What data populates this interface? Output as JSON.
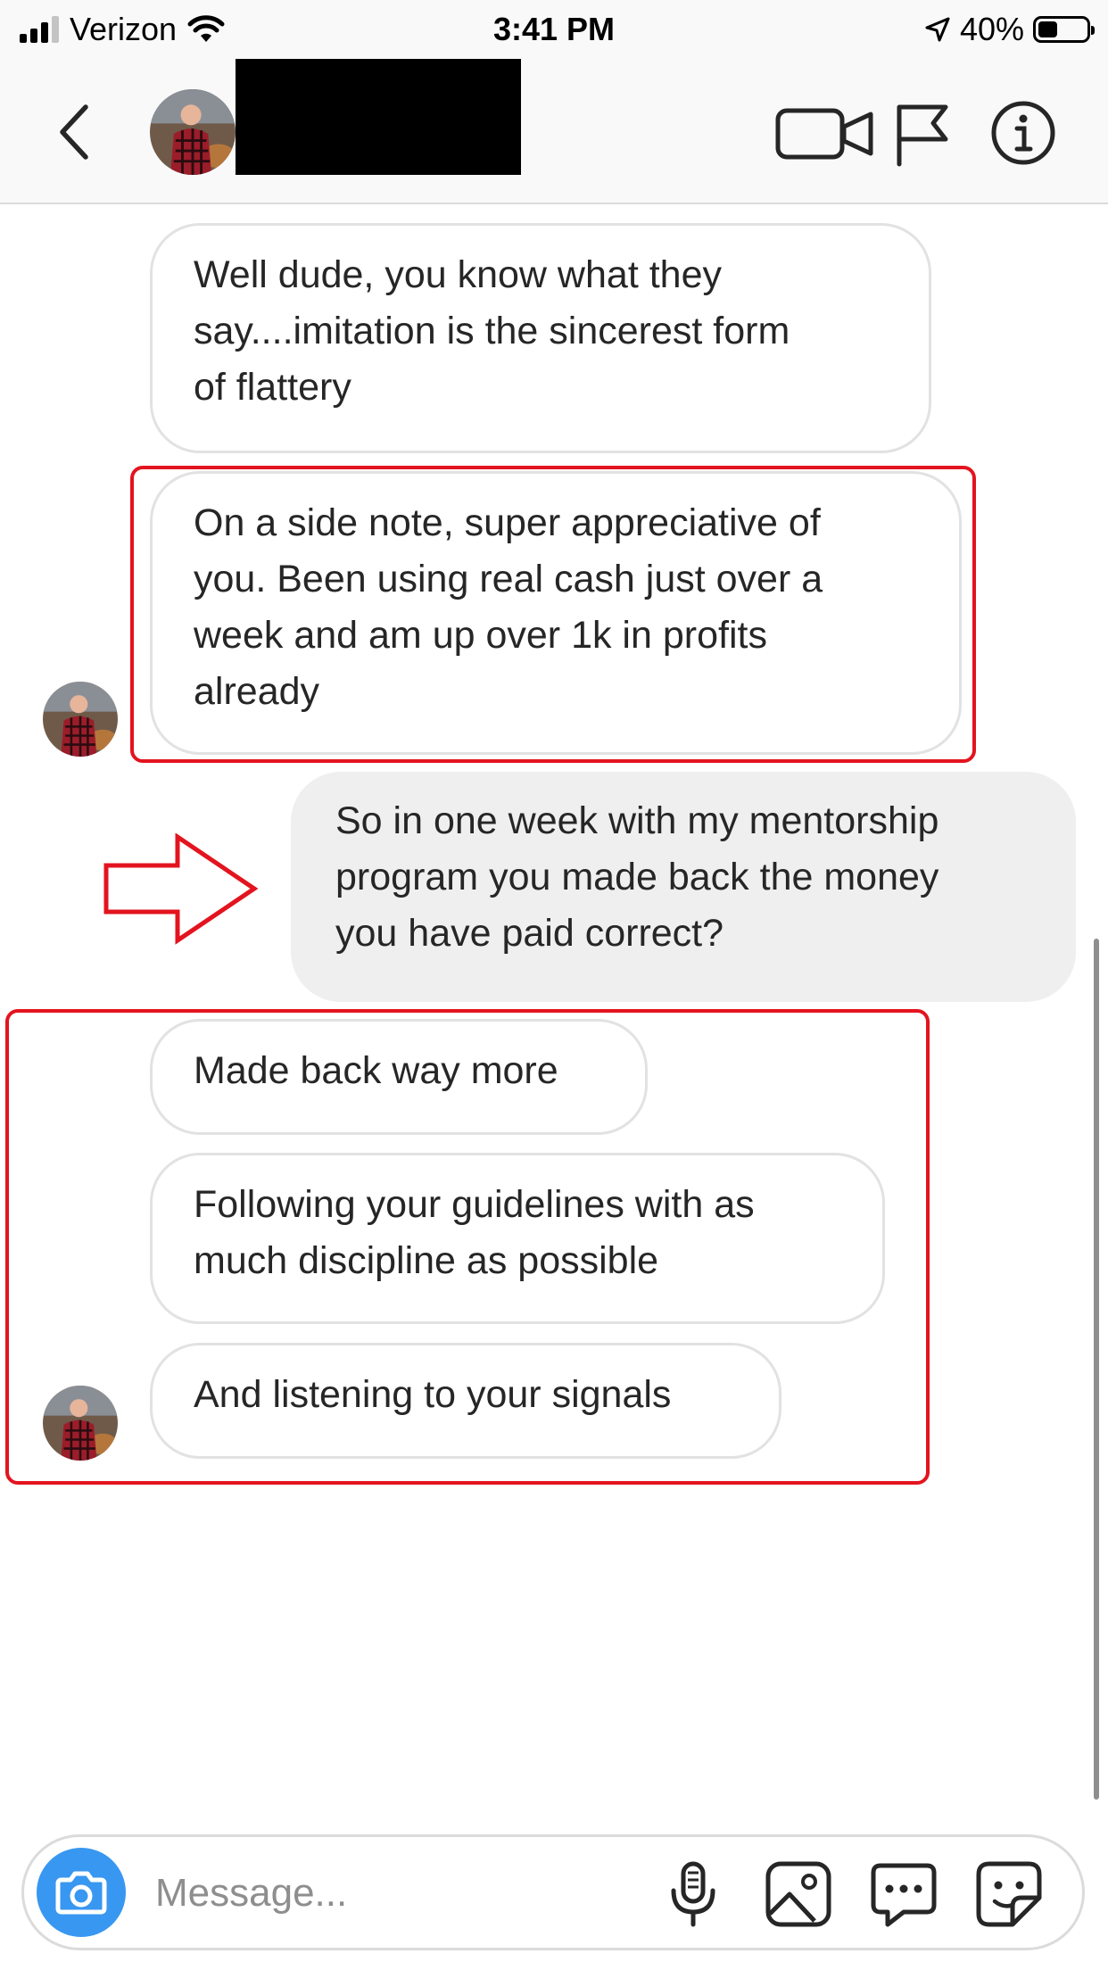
{
  "status_bar": {
    "carrier": "Verizon",
    "time": "3:41 PM",
    "battery_percent": "40%",
    "battery_level": 0.4,
    "signal_bars_active": 3,
    "signal_bars_total": 4
  },
  "header": {
    "contact_name_redacted": true,
    "icons": [
      "chevron-left-icon",
      "video-camera-icon",
      "flag-icon",
      "info-icon"
    ]
  },
  "messages": [
    {
      "from": "them",
      "text": "Well dude, you know what they\nsay....imitation is the sincerest form\nof flattery"
    },
    {
      "from": "them",
      "text": "On a side note, super appreciative of\nyou. Been using real cash just over a\nweek and am up over 1k in profits\nalready"
    },
    {
      "from": "me",
      "text": "So in one week with my mentorship\nprogram you made back the money\nyou have paid correct?"
    },
    {
      "from": "them",
      "text": "Made back way more"
    },
    {
      "from": "them",
      "text": "Following your guidelines with as\nmuch discipline as possible"
    },
    {
      "from": "them",
      "text": "And listening to your signals"
    }
  ],
  "composer": {
    "placeholder": "Message...",
    "icons": [
      "camera-icon",
      "microphone-icon",
      "gallery-icon",
      "quick-reply-icon",
      "sticker-icon"
    ]
  },
  "colors": {
    "highlight": "#e3141f",
    "camera_button": "#3897f0",
    "outgoing_bubble": "#efefef",
    "incoming_border": "#e2e2e2"
  }
}
